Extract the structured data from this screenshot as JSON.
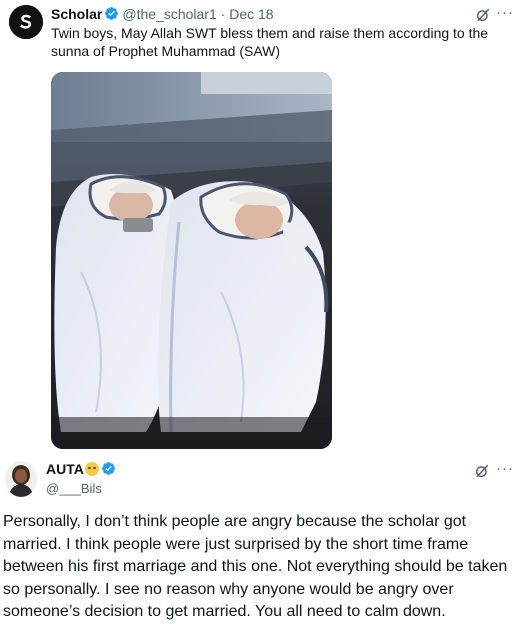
{
  "quoted_post": {
    "author_name": "Scholar",
    "author_handle": "@the_scholar1",
    "separator": "·",
    "date": "Dec 18",
    "avatar_letter": "S",
    "text": "Twin boys, May Allah SWT bless them and raise them according to the sunna of Prophet Muhammad (SAW)",
    "more_label": "···"
  },
  "reply_post": {
    "author_name": "AUTA",
    "author_handle": "@___Bils",
    "more_label": "···",
    "text": "Personally, I don’t think people are angry because the scholar got married. I think people were just surprised by the short time frame between his first marriage and this one. Not everything should be taken so personally. I see no reason why anyone would be angry over someone’s decision to get married. You all need to calm down."
  },
  "icons": {
    "verified": "verified-badge-icon",
    "grok": "grok-icon",
    "more": "more-icon",
    "emoji": "smiling-face-emoji-icon"
  },
  "colors": {
    "text": "#0f1419",
    "muted": "#536471",
    "verified": "#1d9bf0"
  }
}
